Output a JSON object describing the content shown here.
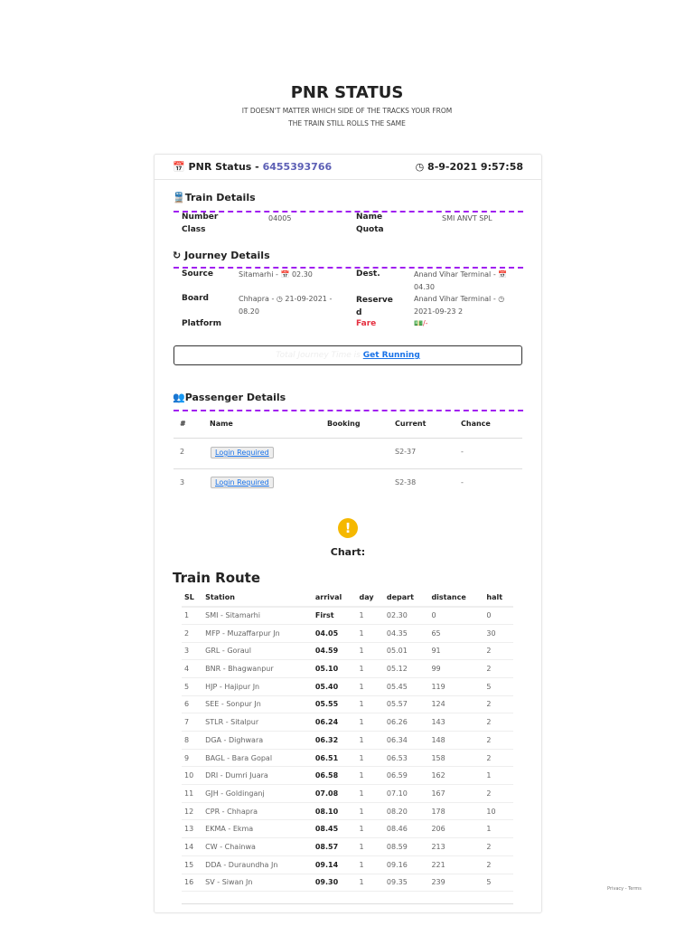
{
  "header": {
    "title": "PNR STATUS",
    "subtitle_line1": "IT DOESN'T MATTER WHICH SIDE OF THE TRACKS YOUR FROM",
    "subtitle_line2": "THE TRAIN STILL ROLLS THE SAME"
  },
  "pnr": {
    "label": "PNR Status - ",
    "number": "6455393766",
    "datetime": "8-9-2021 9:57:58"
  },
  "train_details": {
    "heading": "Train Details",
    "number_label": "Number",
    "number": "04005",
    "name_label": "Name",
    "name": "SMI ANVT SPL",
    "class_label": "Class",
    "quota_label": "Quota"
  },
  "journey": {
    "heading": "Journey Details",
    "source_label": "Source",
    "source": "Sitamarhi - ",
    "source_time": "02.30",
    "dest_label": "Dest.",
    "dest": "Anand Vihar Terminal - ",
    "dest_time": "04.30",
    "board_label": "Board",
    "board": "Chhapra - ",
    "board_time": "21-09-2021 - 08.20",
    "reserve_label": "Reserved",
    "reserve": "Anand Vihar Terminal - ",
    "reserve_time": "2021-09-23 2",
    "platform_label": "Platform",
    "fare_label": "Fare",
    "fare": "/-",
    "total_time_label": "Total Journey Time is",
    "get_running": "Get Running"
  },
  "passengers": {
    "heading": "Passenger Details",
    "columns": [
      "#",
      "Name",
      "Booking",
      "Current",
      "Chance"
    ],
    "rows": [
      {
        "num": "2",
        "name": "Login Required",
        "booking": "",
        "current": "S2-37",
        "chance": "-"
      },
      {
        "num": "3",
        "name": "Login Required",
        "booking": "",
        "current": "S2-38",
        "chance": "-"
      }
    ]
  },
  "chart": {
    "label": "Chart:"
  },
  "route": {
    "heading": "Train Route",
    "columns": [
      "SL",
      "Station",
      "arrival",
      "day",
      "depart",
      "distance",
      "halt"
    ],
    "rows": [
      [
        "1",
        "SMI - Sitamarhi",
        "First",
        "1",
        "02.30",
        "0",
        "0"
      ],
      [
        "2",
        "MFP - Muzaffarpur Jn",
        "04.05",
        "1",
        "04.35",
        "65",
        "30"
      ],
      [
        "3",
        "GRL - Goraul",
        "04.59",
        "1",
        "05.01",
        "91",
        "2"
      ],
      [
        "4",
        "BNR - Bhagwanpur",
        "05.10",
        "1",
        "05.12",
        "99",
        "2"
      ],
      [
        "5",
        "HJP - Hajipur Jn",
        "05.40",
        "1",
        "05.45",
        "119",
        "5"
      ],
      [
        "6",
        "SEE - Sonpur Jn",
        "05.55",
        "1",
        "05.57",
        "124",
        "2"
      ],
      [
        "7",
        "STLR - Sitalpur",
        "06.24",
        "1",
        "06.26",
        "143",
        "2"
      ],
      [
        "8",
        "DGA - Dighwara",
        "06.32",
        "1",
        "06.34",
        "148",
        "2"
      ],
      [
        "9",
        "BAGL - Bara Gopal",
        "06.51",
        "1",
        "06.53",
        "158",
        "2"
      ],
      [
        "10",
        "DRI - Dumri Juara",
        "06.58",
        "1",
        "06.59",
        "162",
        "1"
      ],
      [
        "11",
        "GJH - Goldinganj",
        "07.08",
        "1",
        "07.10",
        "167",
        "2"
      ],
      [
        "12",
        "CPR - Chhapra",
        "08.10",
        "1",
        "08.20",
        "178",
        "10"
      ],
      [
        "13",
        "EKMA - Ekma",
        "08.45",
        "1",
        "08.46",
        "206",
        "1"
      ],
      [
        "14",
        "CW - Chainwa",
        "08.57",
        "1",
        "08.59",
        "213",
        "2"
      ],
      [
        "15",
        "DDA - Duraundha Jn",
        "09.14",
        "1",
        "09.16",
        "221",
        "2"
      ],
      [
        "16",
        "SV - Siwan Jn",
        "09.30",
        "1",
        "09.35",
        "239",
        "5"
      ]
    ]
  },
  "footer": {
    "recaptcha": "Privacy - Terms"
  }
}
